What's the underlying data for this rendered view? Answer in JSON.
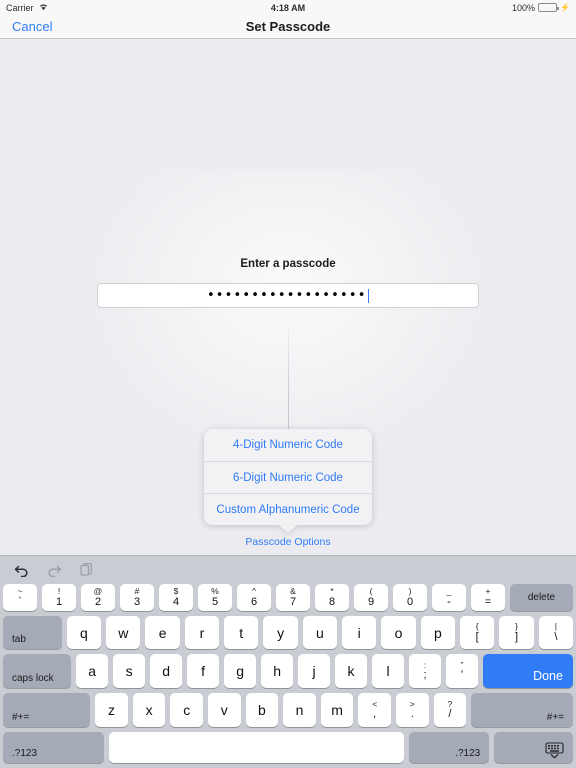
{
  "status_bar": {
    "carrier": "Carrier",
    "wifi_icon": "wifi-icon",
    "time": "4:18 AM",
    "battery_percent": "100%",
    "battery_icon": "battery-full-icon",
    "charging_icon": "lightning-bolt-icon",
    "battery_color": "#4cd964"
  },
  "nav_bar": {
    "cancel_label": "Cancel",
    "title": "Set Passcode",
    "tint_color": "#2f7cf6"
  },
  "content": {
    "prompt": "Enter a passcode",
    "passcode_value": "••••••••••••••••••",
    "field_placeholder": ""
  },
  "popover": {
    "items": [
      {
        "label": "4-Digit Numeric Code"
      },
      {
        "label": "6-Digit Numeric Code"
      },
      {
        "label": "Custom Alphanumeric Code"
      }
    ],
    "background": "#f2f2f4",
    "text_color": "#2f7cf6"
  },
  "passcode_options_label": "Passcode Options",
  "keyboard": {
    "toolbar": [
      {
        "name": "undo-icon",
        "enabled": true
      },
      {
        "name": "redo-icon",
        "enabled": false
      },
      {
        "name": "paste-icon",
        "enabled": false
      }
    ],
    "row_numbers": [
      {
        "sup": "~",
        "sub": "`"
      },
      {
        "sup": "!",
        "sub": "1"
      },
      {
        "sup": "@",
        "sub": "2"
      },
      {
        "sup": "#",
        "sub": "3"
      },
      {
        "sup": "$",
        "sub": "4"
      },
      {
        "sup": "%",
        "sub": "5"
      },
      {
        "sup": "^",
        "sub": "6"
      },
      {
        "sup": "&",
        "sub": "7"
      },
      {
        "sup": "*",
        "sub": "8"
      },
      {
        "sup": "(",
        "sub": "9"
      },
      {
        "sup": ")",
        "sub": "0"
      },
      {
        "sup": "_",
        "sub": "-"
      },
      {
        "sup": "+",
        "sub": "="
      }
    ],
    "delete_label": "delete",
    "tab_label": "tab",
    "row_top": [
      "q",
      "w",
      "e",
      "r",
      "t",
      "y",
      "u",
      "i",
      "o",
      "p"
    ],
    "row_top_extra": [
      {
        "sup": "{",
        "sub": "["
      },
      {
        "sup": "}",
        "sub": "]"
      },
      {
        "sup": "|",
        "sub": "\\"
      }
    ],
    "caps_lock_label": "caps lock",
    "row_home": [
      "a",
      "s",
      "d",
      "f",
      "g",
      "h",
      "j",
      "k",
      "l"
    ],
    "row_home_extra": [
      {
        "sup": ":",
        "sub": ";"
      },
      {
        "sup": "”",
        "sub": "’"
      }
    ],
    "done_label": "Done",
    "done_color": "#2f7cf6",
    "shift_left_label": "#+=",
    "shift_right_label": "#+=",
    "row_bottom": [
      "z",
      "x",
      "c",
      "v",
      "b",
      "n",
      "m"
    ],
    "row_bottom_extra": [
      {
        "sup": "<",
        "sub": ","
      },
      {
        "sup": ">",
        "sub": "."
      },
      {
        "sup": "?",
        "sub": "/"
      }
    ],
    "numeric_left_label": ".?123",
    "numeric_right_label": ".?123",
    "space_label": "",
    "dismiss_icon": "hide-keyboard-icon"
  }
}
